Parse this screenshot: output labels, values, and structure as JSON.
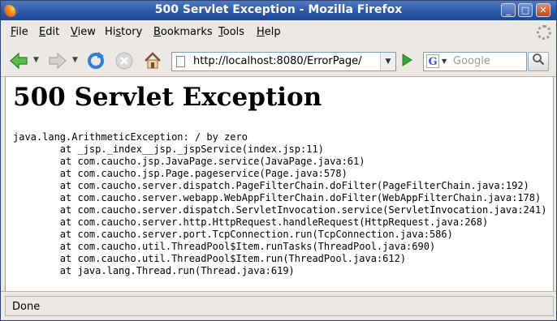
{
  "window": {
    "title": "500 Servlet Exception - Mozilla Firefox",
    "minimize_glyph": "_",
    "maximize_glyph": "□",
    "close_glyph": "✕"
  },
  "menu": {
    "file": {
      "mnemonic": "F",
      "rest": "ile"
    },
    "edit": {
      "mnemonic": "E",
      "rest": "dit"
    },
    "view": {
      "mnemonic": "V",
      "rest": "iew"
    },
    "history": {
      "mnemonic": "s",
      "before": "Hi",
      "rest": "tory"
    },
    "bookmarks": {
      "mnemonic": "B",
      "rest": "ookmarks"
    },
    "tools": {
      "mnemonic": "T",
      "rest": "ools"
    },
    "help": {
      "mnemonic": "H",
      "rest": "elp"
    }
  },
  "toolbar": {
    "back_icon": "back-arrow-icon",
    "forward_icon": "forward-arrow-icon",
    "reload_icon": "reload-icon",
    "stop_icon": "stop-icon",
    "home_icon": "home-icon",
    "url": "http://localhost:8080/ErrorPage/",
    "search_placeholder": "Google",
    "search_engine": "G"
  },
  "page": {
    "heading": "500 Servlet Exception",
    "stack_trace": "java.lang.ArithmeticException: / by zero\n\tat _jsp._index__jsp._jspService(index.jsp:11)\n\tat com.caucho.jsp.JavaPage.service(JavaPage.java:61)\n\tat com.caucho.jsp.Page.pageservice(Page.java:578)\n\tat com.caucho.server.dispatch.PageFilterChain.doFilter(PageFilterChain.java:192)\n\tat com.caucho.server.webapp.WebAppFilterChain.doFilter(WebAppFilterChain.java:178)\n\tat com.caucho.server.dispatch.ServletInvocation.service(ServletInvocation.java:241)\n\tat com.caucho.server.http.HttpRequest.handleRequest(HttpRequest.java:268)\n\tat com.caucho.server.port.TcpConnection.run(TcpConnection.java:586)\n\tat com.caucho.util.ThreadPool$Item.runTasks(ThreadPool.java:690)\n\tat com.caucho.util.ThreadPool$Item.run(ThreadPool.java:612)\n\tat java.lang.Thread.run(Thread.java:619)"
  },
  "status": {
    "text": "Done"
  },
  "colors": {
    "titlebar": "#2c58a8",
    "go_arrow": "#2e9b2e",
    "reload": "#2f7fd6"
  }
}
